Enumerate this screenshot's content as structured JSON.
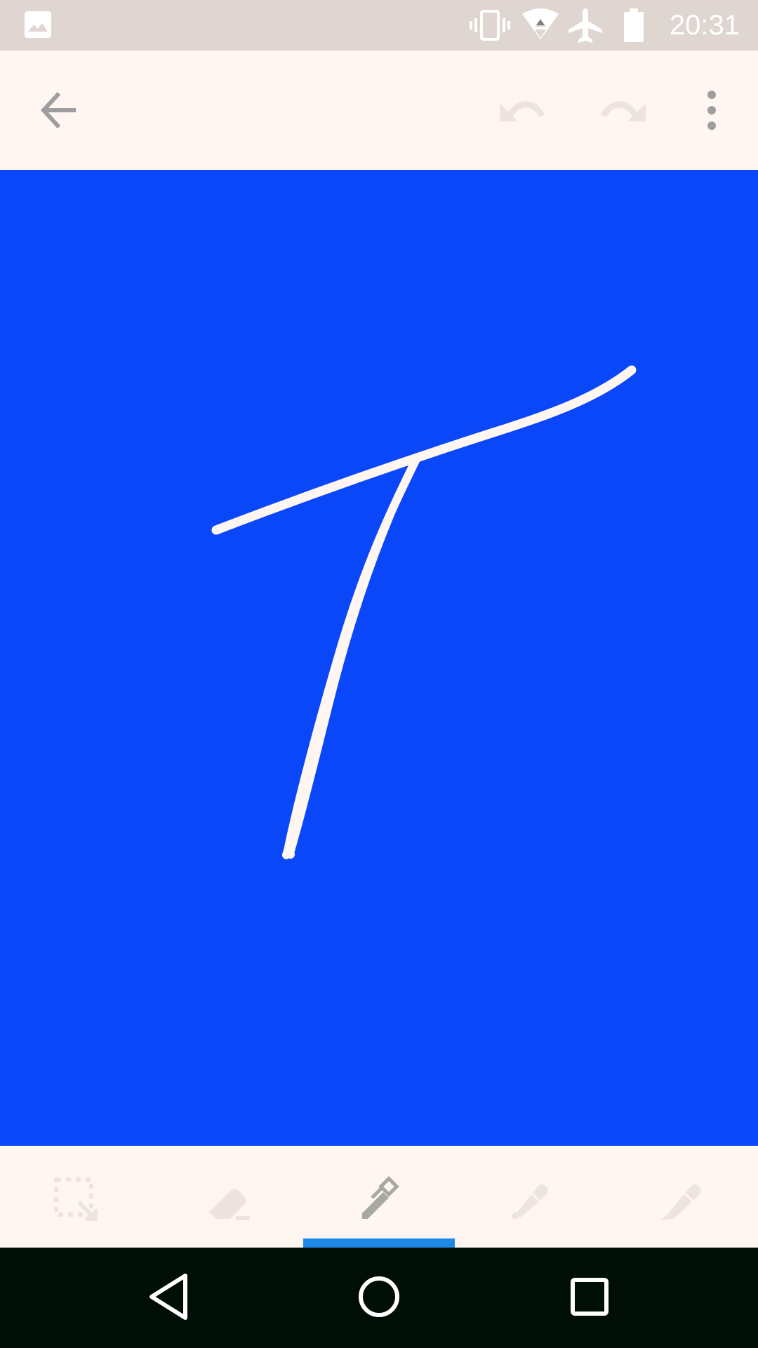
{
  "status_bar": {
    "time": "20:31",
    "icons": [
      "image-notification-icon",
      "vibrate-icon",
      "wifi-icon",
      "airplane-mode-icon",
      "battery-icon"
    ]
  },
  "app_bar": {
    "icons": [
      "back-arrow-icon",
      "undo-icon",
      "redo-icon",
      "more-vert-icon"
    ]
  },
  "canvas": {
    "background_color": "#0A47F8",
    "stroke_color": "#FFF6F2"
  },
  "tool_bar": {
    "tools": [
      "selection-icon",
      "eraser-icon",
      "pen-icon",
      "marker-icon",
      "highlighter-icon"
    ],
    "selected_tool": "pen-icon",
    "indicator_color": "#1E88E5"
  },
  "nav_bar": {
    "icons": [
      "back-triangle-icon",
      "home-circle-icon",
      "recents-square-icon"
    ]
  }
}
